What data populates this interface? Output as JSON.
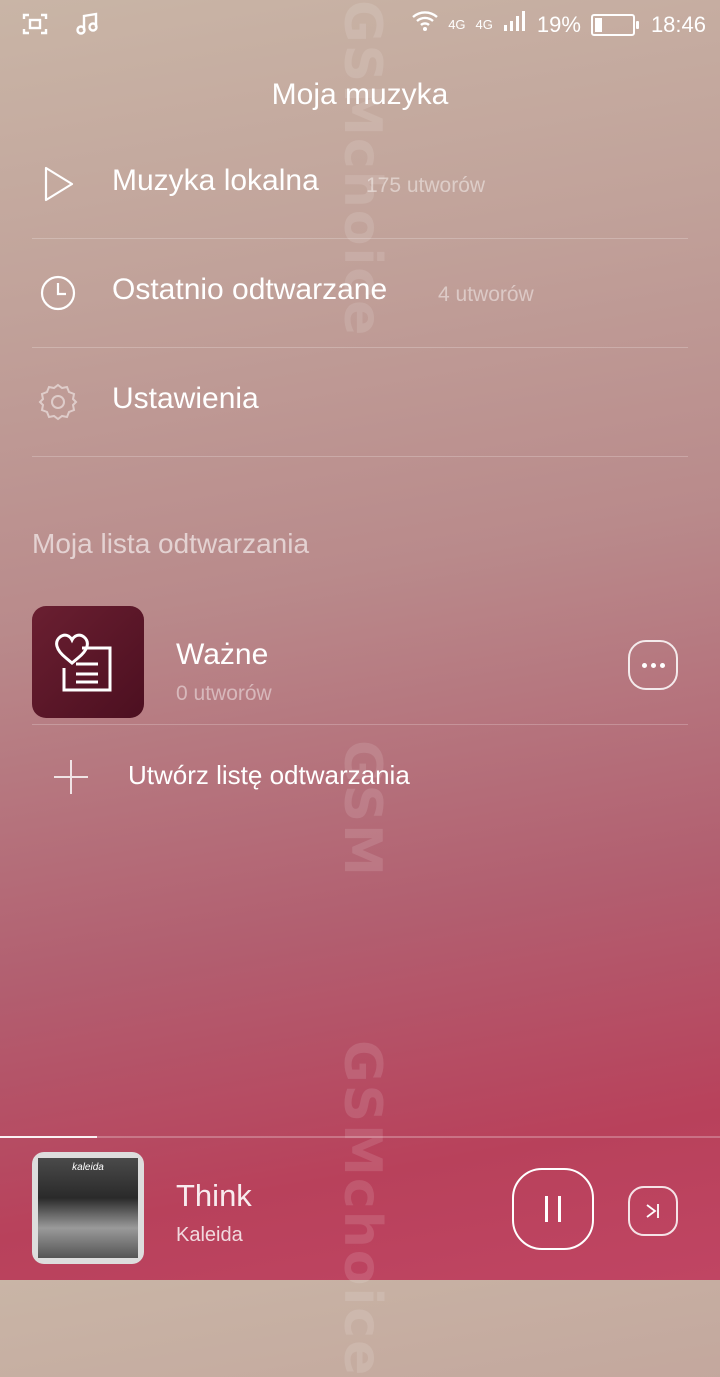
{
  "status_bar": {
    "network1": "4G",
    "network2": "4G",
    "battery_percent": "19%",
    "battery_level": 0.19,
    "time": "18:46"
  },
  "header": {
    "title": "Moja muzyka"
  },
  "menu": {
    "items": [
      {
        "label": "Muzyka lokalna",
        "count": "175 utworów",
        "icon": "play-icon"
      },
      {
        "label": "Ostatnio odtwarzane",
        "count": "4 utworów",
        "icon": "clock-icon"
      },
      {
        "label": "Ustawienia",
        "count": "",
        "icon": "gear-icon"
      }
    ]
  },
  "playlists": {
    "section_title": "Moja lista odtwarzania",
    "items": [
      {
        "name": "Ważne",
        "count": "0 utworów"
      }
    ],
    "create_label": "Utwórz listę odtwarzania"
  },
  "watermark": {
    "text1": "GSMchoice",
    "text2": "GSM",
    "text3": "GSMchoice"
  },
  "now_playing": {
    "title": "Think",
    "artist": "Kaleida",
    "album_text": "kaleida",
    "progress": 0.135
  },
  "colors": {
    "background_top": "#c9b5a6",
    "background_bottom": "#c04563",
    "playlist_cover": "#5a1526"
  }
}
